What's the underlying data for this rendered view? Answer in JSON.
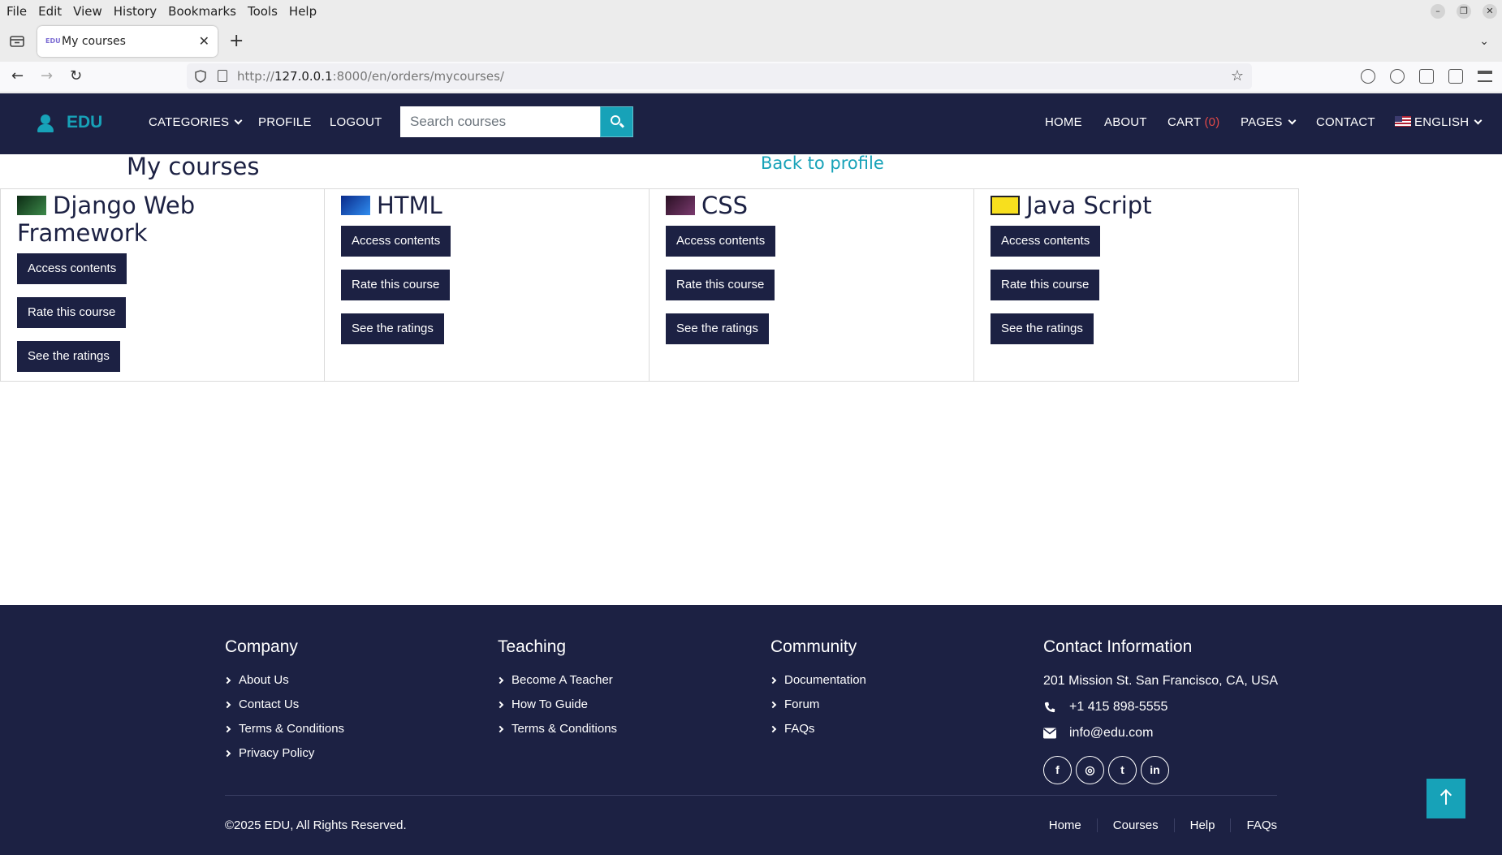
{
  "browser": {
    "menu": [
      "File",
      "Edit",
      "View",
      "History",
      "Bookmarks",
      "Tools",
      "Help"
    ],
    "tab_title": "My courses",
    "favicon_text": "EDU",
    "url_prefix": "http://",
    "url_host": "127.0.0.1",
    "url_rest": ":8000/en/orders/mycourses/"
  },
  "header": {
    "logo": "EDU",
    "categories": "CATEGORIES",
    "profile": "PROFILE",
    "logout": "LOGOUT",
    "search_placeholder": "Search courses",
    "home": "HOME",
    "about": "ABOUT",
    "cart": "CART",
    "cart_count": "(0)",
    "pages": "PAGES",
    "contact": "CONTACT",
    "language": "ENGLISH"
  },
  "main": {
    "title": "My courses",
    "back_link": "Back to profile",
    "buttons": {
      "access": "Access contents",
      "rate": "Rate this course",
      "ratings": "See the ratings"
    },
    "courses": [
      {
        "name": "Django Web Framework",
        "thumb_color": "#1f5f2e"
      },
      {
        "name": "HTML",
        "thumb_color": "#1c4fd8"
      },
      {
        "name": "CSS",
        "thumb_color": "#3a1d36"
      },
      {
        "name": "Java Script",
        "thumb_color": "#f7df1e"
      }
    ]
  },
  "footer": {
    "company": {
      "heading": "Company",
      "links": [
        "About Us",
        "Contact Us",
        "Terms & Conditions",
        "Privacy Policy"
      ]
    },
    "teaching": {
      "heading": "Teaching",
      "links": [
        "Become A Teacher",
        "How To Guide",
        "Terms & Conditions"
      ]
    },
    "community": {
      "heading": "Community",
      "links": [
        "Documentation",
        "Forum",
        "FAQs"
      ]
    },
    "contact": {
      "heading": "Contact Information",
      "address": "201 Mission St. San Francisco, CA, USA",
      "phone": "+1 415 898-5555",
      "email": "info@edu.com"
    },
    "socials": [
      "f",
      "◎",
      "t",
      "in"
    ],
    "copyright": "©2025 EDU, All Rights Reserved.",
    "bottom_links": [
      "Home",
      "Courses",
      "Help",
      "FAQs"
    ]
  },
  "colors": {
    "brand_dark": "#1c2143",
    "accent": "#17a2b8",
    "cart_count": "#e04848"
  }
}
